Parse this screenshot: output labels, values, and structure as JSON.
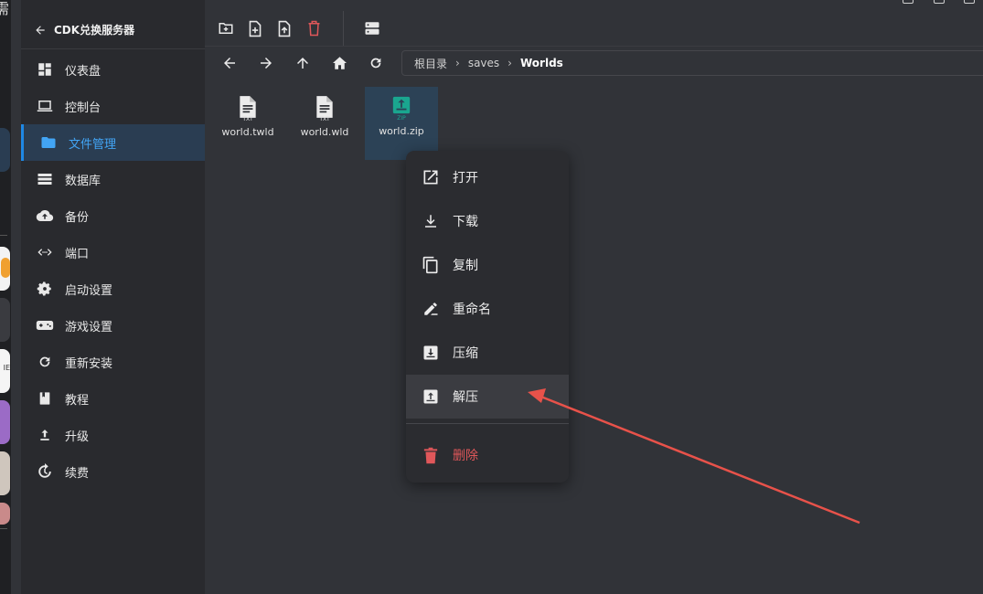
{
  "sidebar": {
    "back_label": "CDK兑换服务器",
    "items": [
      {
        "label": "仪表盘",
        "icon": "dashboard-icon"
      },
      {
        "label": "控制台",
        "icon": "laptop-icon"
      },
      {
        "label": "文件管理",
        "icon": "folder-icon",
        "active": true
      },
      {
        "label": "数据库",
        "icon": "database-icon"
      },
      {
        "label": "备份",
        "icon": "cloud-upload-icon"
      },
      {
        "label": "端口",
        "icon": "port-arrows-icon"
      },
      {
        "label": "启动设置",
        "icon": "gear-icon"
      },
      {
        "label": "游戏设置",
        "icon": "gamepad-icon"
      },
      {
        "label": "重新安装",
        "icon": "refresh-icon"
      },
      {
        "label": "教程",
        "icon": "book-icon"
      },
      {
        "label": "升级",
        "icon": "upload-arrow-icon"
      },
      {
        "label": "续费",
        "icon": "renew-icon"
      }
    ]
  },
  "toolbar": {
    "actions": [
      "new-folder-icon",
      "new-file-icon",
      "upload-file-icon",
      "delete-icon",
      "server-icon"
    ],
    "nav": [
      "arrow-left-icon",
      "arrow-right-icon",
      "arrow-up-icon",
      "home-icon",
      "refresh-icon"
    ]
  },
  "breadcrumb": {
    "root": "根目录",
    "parts": [
      "saves",
      "Worlds"
    ]
  },
  "files": [
    {
      "name": "world.twld",
      "type_label": "TXT",
      "selected": false
    },
    {
      "name": "world.wld",
      "type_label": "TXT",
      "selected": false
    },
    {
      "name": "world.zip",
      "type_label": "ZIP",
      "selected": true
    }
  ],
  "context_menu": {
    "items": [
      {
        "label": "打开",
        "icon": "open-external-icon"
      },
      {
        "label": "下载",
        "icon": "download-icon"
      },
      {
        "label": "复制",
        "icon": "copy-icon"
      },
      {
        "label": "重命名",
        "icon": "rename-pen-icon"
      },
      {
        "label": "压缩",
        "icon": "compress-icon"
      },
      {
        "label": "解压",
        "icon": "extract-icon",
        "highlighted": true
      }
    ],
    "delete_label": "删除"
  },
  "app_strip": {
    "glyph": "需",
    "badge_text": "IE"
  },
  "colors": {
    "accent": "#1e88e5",
    "danger": "#e0575a",
    "annotation_arrow": "#e8524a",
    "zip_icon": "#1aa68f"
  }
}
